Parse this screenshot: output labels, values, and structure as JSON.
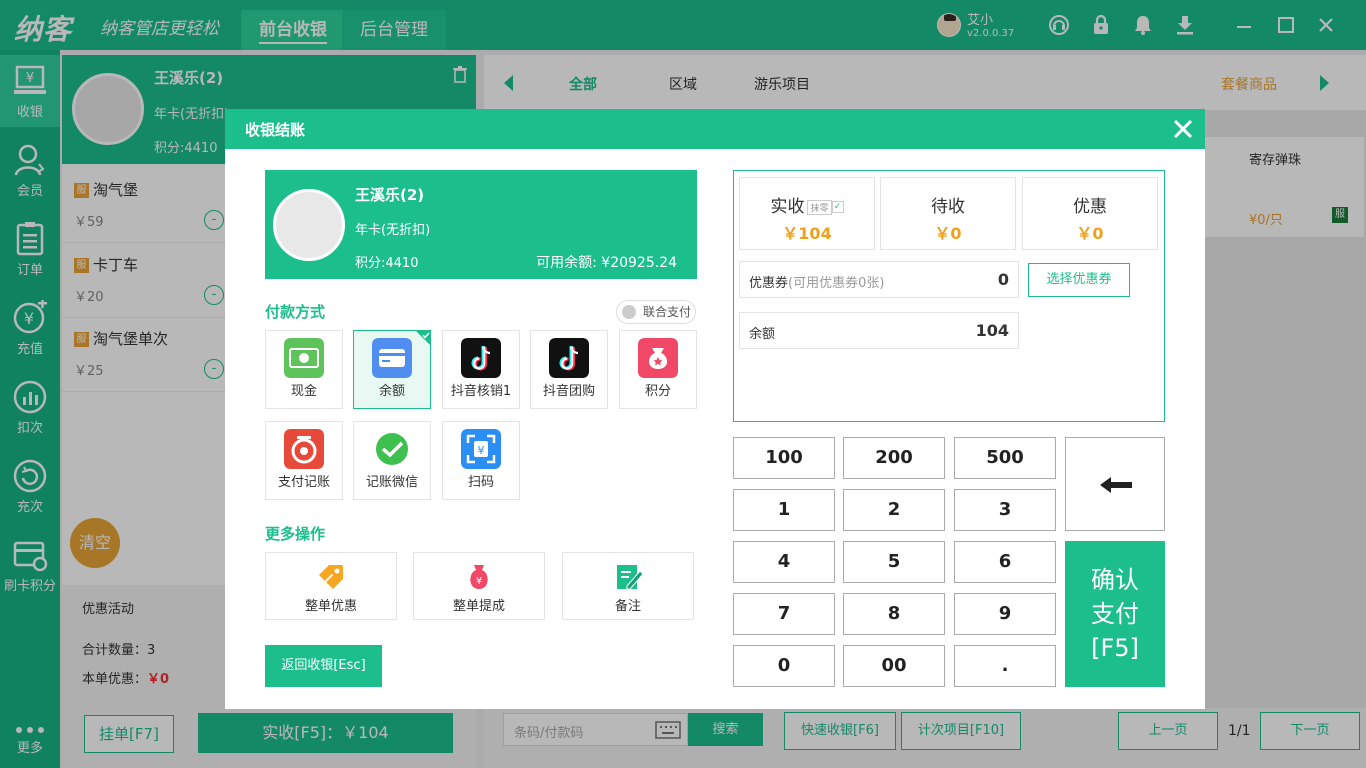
{
  "app": {
    "logo": "纳客",
    "slogan": "纳客管店更轻松",
    "tabs": [
      {
        "label": "前台收银",
        "active": true
      },
      {
        "label": "后台管理",
        "active": false
      }
    ],
    "user": {
      "name": "艾小",
      "version": "v2.0.0.37"
    },
    "window_icons": [
      "support-icon",
      "lock-icon",
      "bell-icon",
      "download-icon",
      "minimize-icon",
      "maximize-icon",
      "close-icon"
    ],
    "accent_color": "#1cbe8c"
  },
  "sidebar": {
    "items": [
      {
        "label": "收银",
        "icon": "cash-register-icon",
        "active": true
      },
      {
        "label": "会员",
        "icon": "member-icon",
        "active": false
      },
      {
        "label": "订单",
        "icon": "order-icon",
        "active": false
      },
      {
        "label": "充值",
        "icon": "recharge-icon",
        "active": false
      },
      {
        "label": "扣次",
        "icon": "deduct-count-icon",
        "active": false
      },
      {
        "label": "充次",
        "icon": "recharge-count-icon",
        "active": false
      },
      {
        "label": "刷卡积分",
        "icon": "card-points-icon",
        "active": false
      },
      {
        "label": "更多",
        "icon": "more-icon",
        "active": false
      }
    ]
  },
  "cart": {
    "member": {
      "name": "王溪乐(2)",
      "card": "年卡(无折扣)",
      "points": "积分:4410"
    },
    "items": [
      {
        "badge": "服",
        "name": "淘气堡",
        "price": "￥59"
      },
      {
        "badge": "服",
        "name": "卡丁车",
        "price": "￥20"
      },
      {
        "badge": "服",
        "name": "淘气堡单次",
        "price": "￥25"
      }
    ],
    "clear_label": "清空",
    "promo_label": "优惠活动",
    "total_qty": "合计数量：3",
    "discount_label": "本单优惠：",
    "discount_value": "￥0",
    "hold_label": "挂单[F7]",
    "pay_label": "实收[F5]：￥104"
  },
  "products": {
    "categories": [
      "全部",
      "区域",
      "游乐项目",
      "套餐商品"
    ],
    "card": {
      "name": "寄存弹珠",
      "price": "¥0/只",
      "badge": "服"
    },
    "search_placeholder": "条码/付款码",
    "search_label": "搜索",
    "quick_label": "快速收银[F6]",
    "count_label": "计次项目[F10]",
    "prev_label": "上一页",
    "page": "1/1",
    "next_label": "下一页"
  },
  "modal": {
    "title": "收银结账",
    "member": {
      "name": "王溪乐(2)",
      "card": "年卡(无折扣)",
      "points": "积分:4410",
      "balance": "可用余额: ¥20925.24"
    },
    "pay_section": "付款方式",
    "joint_pay": "联合支付",
    "pay_methods": [
      {
        "label": "现金",
        "icon": "cash-icon",
        "color": "#5ec35a",
        "selected": false
      },
      {
        "label": "余额",
        "icon": "balance-card-icon",
        "color": "#4f8ef0",
        "selected": true
      },
      {
        "label": "抖音核销1",
        "icon": "douyin-icon",
        "color": "#111111",
        "selected": false
      },
      {
        "label": "抖音团购",
        "icon": "douyin-icon",
        "color": "#111111",
        "selected": false
      },
      {
        "label": "积分",
        "icon": "points-bag-icon",
        "color": "#f04866",
        "selected": false
      },
      {
        "label": "支付记账",
        "icon": "record-pay-icon",
        "color": "#e84a3a",
        "selected": false
      },
      {
        "label": "记账微信",
        "icon": "wechat-check-icon",
        "color": "#3ec04f",
        "selected": false
      },
      {
        "label": "扫码",
        "icon": "scan-code-icon",
        "color": "#2a8ef4",
        "selected": false
      }
    ],
    "more_section": "更多操作",
    "operations": [
      {
        "label": "整单优惠",
        "icon": "discount-tag-icon"
      },
      {
        "label": "整单提成",
        "icon": "commission-bag-icon"
      },
      {
        "label": "备注",
        "icon": "note-edit-icon"
      }
    ],
    "back_label": "返回收银[Esc]",
    "summary": {
      "received_label": "实收",
      "moling_label": "抹零",
      "received_value": "￥104",
      "pending_label": "待收",
      "pending_value": "￥0",
      "discount_label": "优惠",
      "discount_value": "￥0",
      "coupon_label": "优惠券",
      "coupon_sub": "(可用优惠券0张)",
      "coupon_value": "0",
      "coupon_button": "选择优惠券",
      "balance_label": "余额",
      "balance_value": "104"
    },
    "keypad": [
      "100",
      "200",
      "500",
      "1",
      "2",
      "3",
      "4",
      "5",
      "6",
      "7",
      "8",
      "9",
      "0",
      "00",
      "."
    ],
    "confirm_lines": [
      "确认",
      "支付",
      "[F5]"
    ]
  }
}
